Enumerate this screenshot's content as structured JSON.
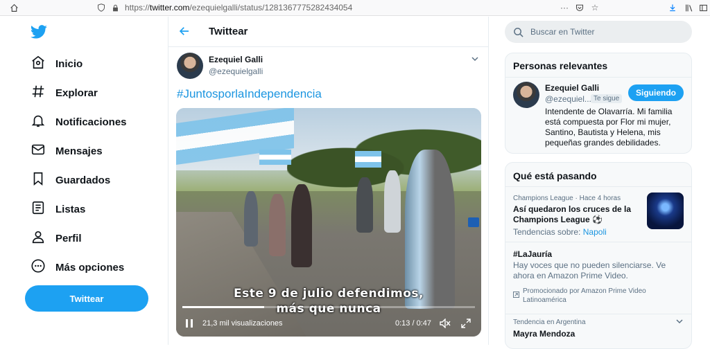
{
  "browser": {
    "url_prefix": "https://",
    "url_domain": "twitter.com",
    "url_path": "/ezequielgalli/status/1281367775282434054"
  },
  "nav": {
    "items": [
      {
        "label": "Inicio",
        "icon": "home-icon"
      },
      {
        "label": "Explorar",
        "icon": "hashtag-icon"
      },
      {
        "label": "Notificaciones",
        "icon": "bell-icon"
      },
      {
        "label": "Mensajes",
        "icon": "mail-icon"
      },
      {
        "label": "Guardados",
        "icon": "bookmark-icon"
      },
      {
        "label": "Listas",
        "icon": "list-icon"
      },
      {
        "label": "Perfil",
        "icon": "person-icon"
      },
      {
        "label": "Más opciones",
        "icon": "more-icon"
      }
    ],
    "tweet_button": "Twittear"
  },
  "main": {
    "header_title": "Twittear",
    "tweet": {
      "author_name": "Ezequiel Galli",
      "author_handle": "@ezequielgalli",
      "hashtag": "#JuntosporlaIndependencia",
      "video": {
        "subtitle_line1": "Este 9 de julio defendimos,",
        "subtitle_line2": "más que nunca",
        "views": "21,3 mil visualizaciones",
        "time": "0:13 / 0:47",
        "progress": 0.28
      }
    }
  },
  "right": {
    "search_placeholder": "Buscar en Twitter",
    "relevant": {
      "title": "Personas relevantes",
      "name": "Ezequiel Galli",
      "handle": "@ezequiel...",
      "follows_you": "Te sigue",
      "follow_button": "Siguiendo",
      "bio": "Intendente de Olavarría. Mi familia está compuesta por Flor mi mujer, Santino, Bautista y Helena, mis pequeñas grandes debilidades."
    },
    "trends": {
      "title": "Qué está pasando",
      "items": [
        {
          "meta": "Champions League · Hace 4 horas",
          "headline": "Así quedaron los cruces de la Champions League ⚽",
          "topics_label": "Tendencias sobre:",
          "topics_link": "Napoli"
        },
        {
          "headline": "#LaJauría",
          "body": "Hay voces que no pueden silenciarse. Ve ahora en Amazon Prime Video.",
          "promoted": "Promocionado por Amazon Prime Video Latinoamérica"
        },
        {
          "meta": "Tendencia en Argentina",
          "headline": "Mayra Mendoza"
        }
      ]
    }
  },
  "colors": {
    "accent": "#1da1f2",
    "link": "#1b95e0",
    "text": "#0f1419",
    "muted": "#5b7083"
  }
}
